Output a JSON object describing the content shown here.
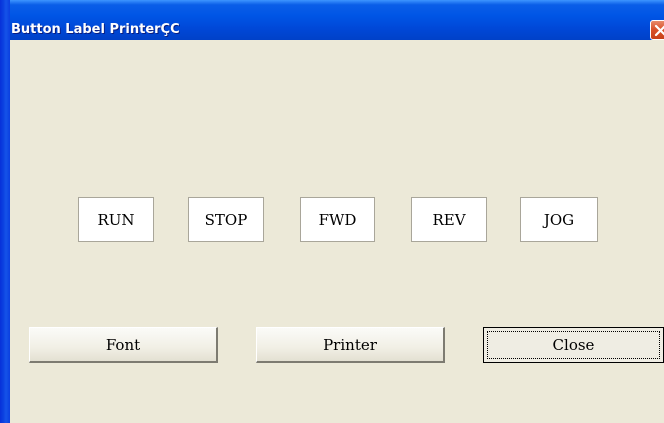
{
  "window": {
    "title": "Button Label PrinterÇC"
  },
  "labels": [
    {
      "text": "RUN"
    },
    {
      "text": "STOP"
    },
    {
      "text": "FWD"
    },
    {
      "text": "REV"
    },
    {
      "text": "JOG"
    }
  ],
  "buttons": {
    "font_label": "Font",
    "printer_label": "Printer",
    "close_label": "Close"
  },
  "icons": {
    "close": "close-icon"
  },
  "colors": {
    "titlebar": "#0055e5",
    "window_bg": "#ece9d8",
    "close_button": "#d9532c"
  }
}
